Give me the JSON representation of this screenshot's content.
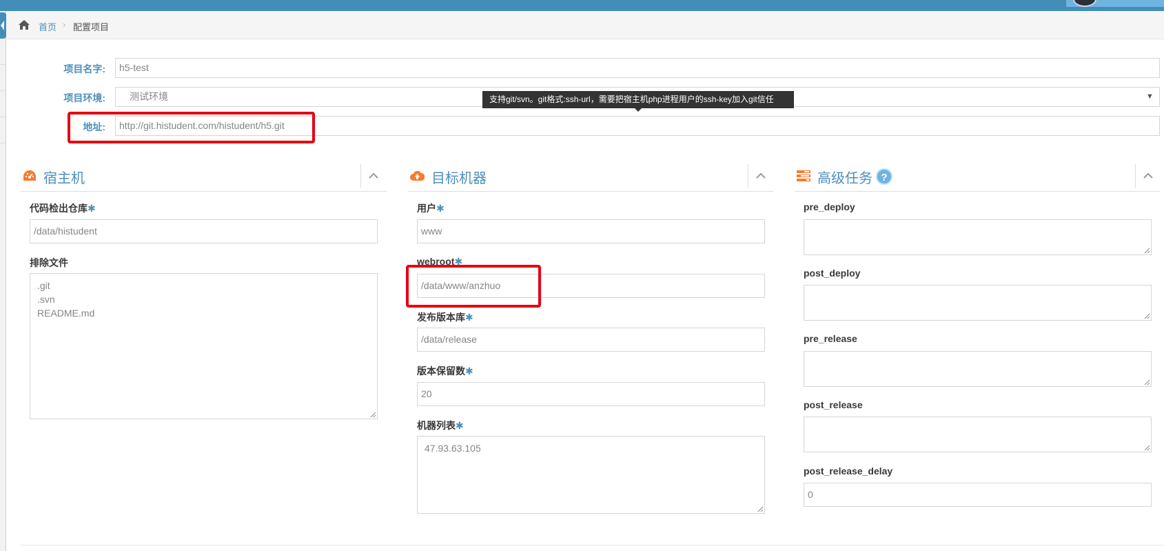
{
  "breadcrumb": {
    "home": "首页",
    "separator": "›",
    "current": "配置项目",
    "home_icon": "home-icon"
  },
  "form": {
    "project_name": {
      "label": "项目名字:",
      "value": "h5-test"
    },
    "environment": {
      "label": "项目环境:",
      "value": "测试环境",
      "arrow": "▼"
    },
    "address": {
      "label": "地址:",
      "value": "http://git.histudent.com/histudent/h5.git"
    },
    "tooltip": "支持git/svn。git格式:ssh-url，需要把宿主机php进程用户的ssh-key加入git信任"
  },
  "panels": {
    "host": {
      "title": "宿主机",
      "icon": "dashboard-icon",
      "repo": {
        "label": "代码检出仓库",
        "required": "✱",
        "value": "/data/histudent"
      },
      "excludes": {
        "label": "排除文件",
        "value": ".git\n.svn\nREADME.md"
      }
    },
    "target": {
      "title": "目标机器",
      "icon": "cloud-upload-icon",
      "user": {
        "label": "用户",
        "required": "✱",
        "value": "www"
      },
      "webroot": {
        "label": "webroot",
        "required": "✱",
        "value": "/data/www/anzhuo"
      },
      "release_lib": {
        "label": "发布版本库",
        "required": "✱",
        "value": "/data/release"
      },
      "keep_versions": {
        "label": "版本保留数",
        "required": "✱",
        "value": "20"
      },
      "hosts": {
        "label": "机器列表",
        "required": "✱",
        "value": "47.93.63.105"
      }
    },
    "tasks": {
      "title": "高级任务",
      "icon": "tasks-icon",
      "help": "?",
      "pre_deploy": {
        "label": "pre_deploy",
        "value": ""
      },
      "post_deploy": {
        "label": "post_deploy",
        "value": ""
      },
      "pre_release": {
        "label": "pre_release",
        "value": ""
      },
      "post_release": {
        "label": "post_release",
        "value": ""
      },
      "post_release_delay": {
        "label": "post_release_delay",
        "value": "0"
      }
    }
  },
  "colors": {
    "accent": "#4c8fbd",
    "topbar": "#438eb9",
    "highlight": "#e60012",
    "icon_orange": "#f77b2b"
  }
}
